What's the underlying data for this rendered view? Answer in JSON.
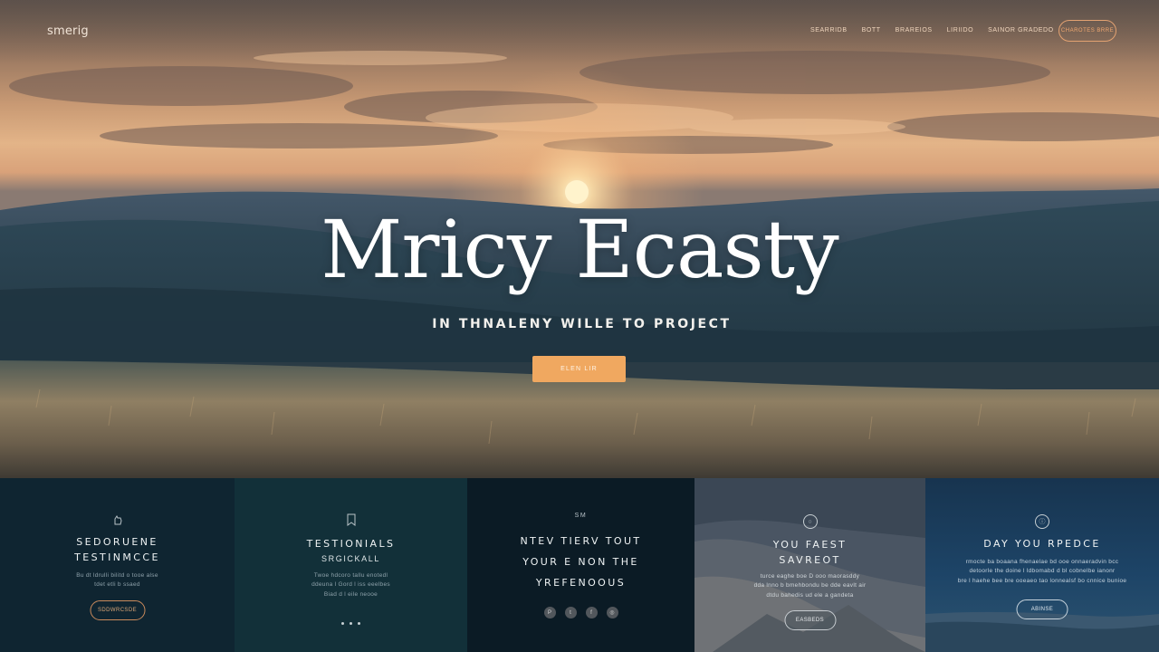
{
  "header": {
    "brand": "smerig",
    "nav": [
      "SEARRIDB",
      "BOTT",
      "BRAREIOS",
      "LIRIIDO",
      "SAINOR GRADEDO"
    ],
    "cta": "CHAROTES BRRE"
  },
  "hero": {
    "title": "Mricy Ecasty",
    "subtitle": "IN THNALENY WILLE TO PROJECT",
    "cta": "ELEN LIR"
  },
  "panels": [
    {
      "icon": "hand-icon",
      "title_line1": "SEDORUENE",
      "title_line2": "TESTINMCCE",
      "body_line1": "Bu dt ldrulli bilitd o tooe alse",
      "body_line2": "tdet etli b ssaed",
      "button": "SDDWRCSDE"
    },
    {
      "icon": "bookmark-icon",
      "title_line1": "TESTIONIALS",
      "title_line2": "SRGICKALL",
      "body_line1": "Twoe hdcoro tallu enotedl",
      "body_line2": "ddeuna l Gord l iss eeelbes",
      "body_line3": "Biad d l eile neooe"
    },
    {
      "kicker": "SM",
      "title_line1": "NTEV TIERV TOUT",
      "title_line2": "YOUR E NON THE",
      "title_line3": "YREFENOOUS",
      "social_icons": [
        "pinterest-icon",
        "twitter-icon",
        "facebook-icon",
        "instagram-icon"
      ]
    },
    {
      "icon": "circle-icon",
      "title_line1": "YOU FAEST",
      "title_line2": "SAVREOT",
      "body_line1": "turce eaghe boe D ooo maorasddy",
      "body_line2": "dda lnno b bmehbondu be dde eavlt air",
      "body_line3": "dtdu bahedis ud ele a gandeta",
      "button": "EASBEDS"
    },
    {
      "icon": "info-icon",
      "title": "DAY YOU RPEDCE",
      "body_line1": "rmocte ba boaana fhenaelae bd ooe onnaeradvin bcc",
      "body_line2": "detoorle the doine l ldbomabd d bl cobnelbe ianonr",
      "body_line3": "bre l haehe bee bre ooeaeo tao lonnealsf bo cnnice bunioe",
      "button": "ABINSE"
    }
  ],
  "colors": {
    "accent": "#f0a860",
    "accent_outline": "#e3a271",
    "panel_dark": "#0f2531"
  }
}
